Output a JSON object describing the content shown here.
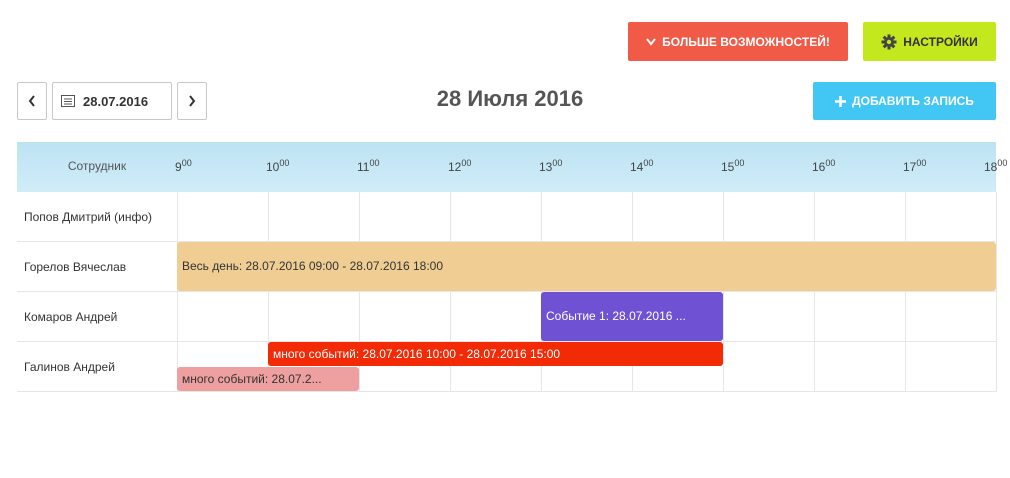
{
  "toolbar": {
    "more_label": "БОЛЬШЕ ВОЗМОЖНОСТЕЙ!",
    "settings_label": "НАСТРОЙКИ",
    "add_label": "ДОБАВИТЬ ЗАПИСЬ",
    "date_value": "28.07.2016",
    "title": "28 Июля 2016"
  },
  "timeline": {
    "employee_header": "Сотрудник",
    "hours": [
      {
        "h": "9",
        "m": "00"
      },
      {
        "h": "10",
        "m": "00"
      },
      {
        "h": "11",
        "m": "00"
      },
      {
        "h": "12",
        "m": "00"
      },
      {
        "h": "13",
        "m": "00"
      },
      {
        "h": "14",
        "m": "00"
      },
      {
        "h": "15",
        "m": "00"
      },
      {
        "h": "16",
        "m": "00"
      },
      {
        "h": "17",
        "m": "00"
      },
      {
        "h": "18",
        "m": "00"
      }
    ],
    "employees": [
      "Попов Дмитрий (инфо)",
      "Горелов Вячеслав",
      "Комаров Андрей",
      "Галинов Андрей"
    ],
    "events": [
      {
        "label": "Весь день: 28.07.2016 09:00 - 28.07.2016 18:00",
        "row": 1,
        "start": 9,
        "end": 18,
        "color": "#f0cd93",
        "text_color": "#333"
      },
      {
        "label": "Событие 1: 28.07.2016 ...",
        "row": 2,
        "start": 13,
        "end": 15,
        "color": "#6f52d3",
        "text_color": "#ffffff"
      },
      {
        "label": "много событий: 28.07.2016 10:00 - 28.07.2016 15:00",
        "row": 3,
        "start": 10,
        "end": 15,
        "color": "#f22a05",
        "text_color": "#ffffff",
        "lane": 0
      },
      {
        "label": "много событий: 28.07.2...",
        "row": 3,
        "start": 9,
        "end": 11,
        "color": "#ee9f9f",
        "text_color": "#333",
        "lane": 1
      }
    ]
  },
  "colors": {
    "more": "#f05a47",
    "settings": "#c3e81e",
    "add": "#42c6f4",
    "header": "#c6e7f5"
  }
}
